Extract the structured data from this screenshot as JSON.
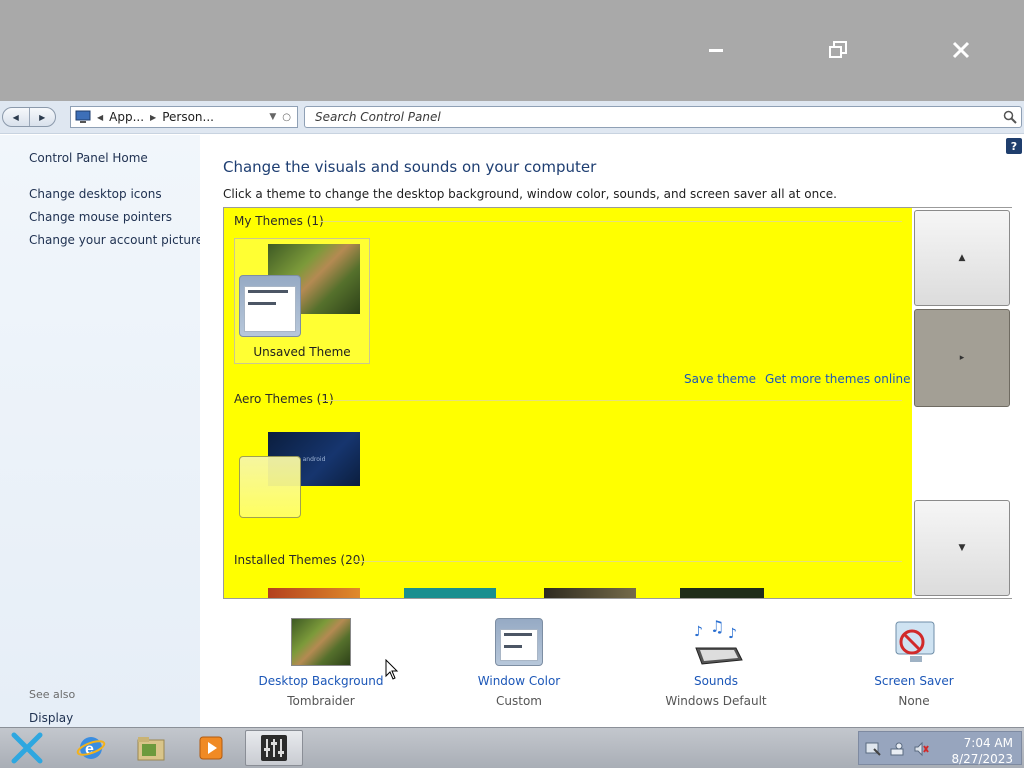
{
  "window": {
    "minimize_icon": "minimize-icon",
    "maximize_icon": "restore-icon",
    "close_icon": "close-icon"
  },
  "address": {
    "crumbs": [
      "App...",
      "Person..."
    ],
    "search_placeholder": "Search Control Panel"
  },
  "left_pane": {
    "home": "Control Panel Home",
    "links": [
      "Change desktop icons",
      "Change mouse pointers",
      "Change your account picture"
    ],
    "see_also": "See also",
    "see_also_links": [
      "Display"
    ]
  },
  "main": {
    "help": "?",
    "heading": "Change the visuals and sounds on your computer",
    "subheading": "Click a theme to change the desktop background, window color, sounds, and screen saver all at once.",
    "groups": {
      "my_themes": "My Themes (1)",
      "aero_themes": "Aero Themes (1)",
      "installed_themes": "Installed Themes (20)"
    },
    "my_theme_tile": "Unsaved Theme",
    "save_theme": "Save theme",
    "get_more": "Get more themes online",
    "aero_thumb_text": "android"
  },
  "shortcuts": [
    {
      "name": "Desktop Background",
      "value": "Tombraider"
    },
    {
      "name": "Window Color",
      "value": "Custom"
    },
    {
      "name": "Sounds",
      "value": "Windows Default"
    },
    {
      "name": "Screen Saver",
      "value": "None"
    }
  ],
  "taskbar": {
    "time": "7:04 AM",
    "date": "8/27/2023"
  },
  "colors": {
    "theme_panel_bg": "#ffff00",
    "link": "#1c57b8",
    "heading": "#1e3e72",
    "titlebar": "#a9a9a9"
  }
}
